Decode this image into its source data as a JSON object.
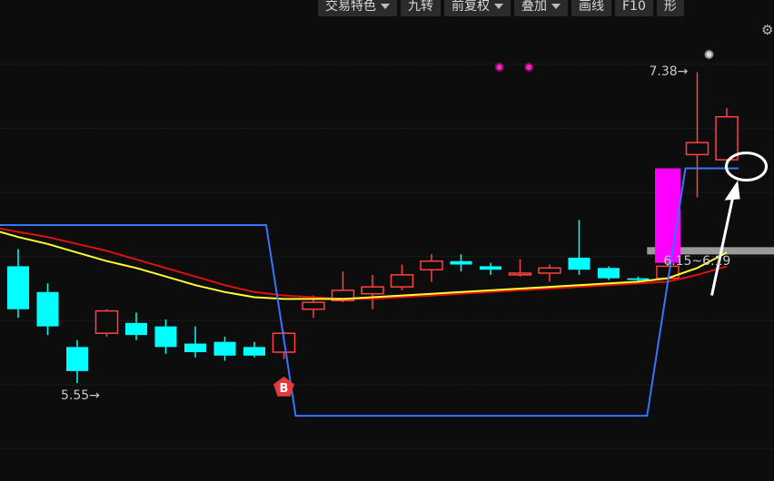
{
  "toolbar": {
    "items": [
      {
        "label": "交易特色",
        "dropdown": true
      },
      {
        "label": "九转",
        "dropdown": false
      },
      {
        "label": "前复权",
        "dropdown": true
      },
      {
        "label": "叠加",
        "dropdown": true
      },
      {
        "label": "画线",
        "dropdown": false
      },
      {
        "label": "F10",
        "dropdown": false
      },
      {
        "label": "形",
        "dropdown": false
      }
    ],
    "settings_icon": "gear-icon"
  },
  "chart_data": {
    "type": "candlestick",
    "ylim": [
      5.0,
      7.8
    ],
    "grid": true,
    "colors": {
      "up": "#ff4242",
      "down": "#00ffff",
      "ma_yellow": "#ffff33",
      "ma_red": "#e01010",
      "blue_line": "#3575ff",
      "magenta_bar": "#ff00ff",
      "band": "#9a9a9a"
    },
    "candles": [
      {
        "o": 6.25,
        "c": 6.0,
        "h": 6.35,
        "l": 5.95
      },
      {
        "o": 6.1,
        "c": 5.9,
        "h": 6.15,
        "l": 5.85
      },
      {
        "o": 5.78,
        "c": 5.64,
        "h": 5.82,
        "l": 5.57
      },
      {
        "o": 5.86,
        "c": 5.99,
        "h": 6.0,
        "l": 5.84
      },
      {
        "o": 5.92,
        "c": 5.85,
        "h": 5.98,
        "l": 5.82
      },
      {
        "o": 5.9,
        "c": 5.78,
        "h": 5.94,
        "l": 5.74
      },
      {
        "o": 5.8,
        "c": 5.75,
        "h": 5.9,
        "l": 5.72
      },
      {
        "o": 5.81,
        "c": 5.73,
        "h": 5.84,
        "l": 5.7
      },
      {
        "o": 5.78,
        "c": 5.73,
        "h": 5.81,
        "l": 5.72
      },
      {
        "o": 5.75,
        "c": 5.86,
        "h": 5.87,
        "l": 5.71
      },
      {
        "o": 6.0,
        "c": 6.04,
        "h": 6.08,
        "l": 5.95
      },
      {
        "o": 6.05,
        "c": 6.11,
        "h": 6.22,
        "l": 6.04
      },
      {
        "o": 6.09,
        "c": 6.13,
        "h": 6.2,
        "l": 6.0
      },
      {
        "o": 6.13,
        "c": 6.2,
        "h": 6.26,
        "l": 6.11
      },
      {
        "o": 6.23,
        "c": 6.28,
        "h": 6.32,
        "l": 6.16
      },
      {
        "o": 6.28,
        "c": 6.26,
        "h": 6.32,
        "l": 6.22
      },
      {
        "o": 6.25,
        "c": 6.23,
        "h": 6.27,
        "l": 6.2
      },
      {
        "o": 6.2,
        "c": 6.21,
        "h": 6.29,
        "l": 6.19
      },
      {
        "o": 6.21,
        "c": 6.24,
        "h": 6.26,
        "l": 6.16
      },
      {
        "o": 6.3,
        "c": 6.23,
        "h": 6.52,
        "l": 6.2
      },
      {
        "o": 6.24,
        "c": 6.18,
        "h": 6.25,
        "l": 6.17
      },
      {
        "o": 6.18,
        "c": 6.17,
        "h": 6.19,
        "l": 6.16
      },
      {
        "o": 6.18,
        "c": 6.25,
        "h": 6.28,
        "l": 6.16
      },
      {
        "o": 6.9,
        "c": 6.97,
        "h": 7.38,
        "l": 6.65
      },
      {
        "o": 6.87,
        "c": 7.12,
        "h": 7.17,
        "l": 6.85
      }
    ],
    "ma_yellow": [
      6.42,
      6.38,
      6.33,
      6.28,
      6.24,
      6.19,
      6.14,
      6.1,
      6.07,
      6.06,
      6.06,
      6.06,
      6.07,
      6.08,
      6.09,
      6.1,
      6.11,
      6.12,
      6.13,
      6.14,
      6.15,
      6.16,
      6.18,
      6.24,
      6.33
    ],
    "ma_red": [
      6.45,
      6.42,
      6.38,
      6.34,
      6.29,
      6.24,
      6.19,
      6.14,
      6.1,
      6.08,
      6.07,
      6.06,
      6.06,
      6.07,
      6.08,
      6.09,
      6.1,
      6.11,
      6.12,
      6.13,
      6.14,
      6.15,
      6.16,
      6.2,
      6.25
    ],
    "blue_line": [
      {
        "i": -1,
        "v": 6.49
      },
      {
        "i": 8.4,
        "v": 6.49
      },
      {
        "i": 9.4,
        "v": 5.38
      },
      {
        "i": 21.3,
        "v": 5.38
      },
      {
        "i": 22.6,
        "v": 6.82
      },
      {
        "i": 23.4,
        "v": 6.82
      },
      {
        "i": 24.4,
        "v": 6.82
      }
    ],
    "magenta_bar": {
      "index": 22,
      "top": 6.82,
      "bottom": 6.27
    },
    "band": {
      "start": 21.3,
      "end": 26,
      "value": 6.34
    },
    "annotations": {
      "high_label": "7.38→",
      "low_label": "5.55→",
      "range_label": "6.15~6.19",
      "buy_marker": "B",
      "buy_index": 9
    },
    "markers": [
      {
        "type": "magenta-dot",
        "index": 16.3
      },
      {
        "type": "magenta-dot",
        "index": 17.3
      },
      {
        "type": "white-dot",
        "index": 23.4
      }
    ],
    "highlight": {
      "shape": "ellipse",
      "index": 24.6,
      "value": 6.82
    }
  }
}
